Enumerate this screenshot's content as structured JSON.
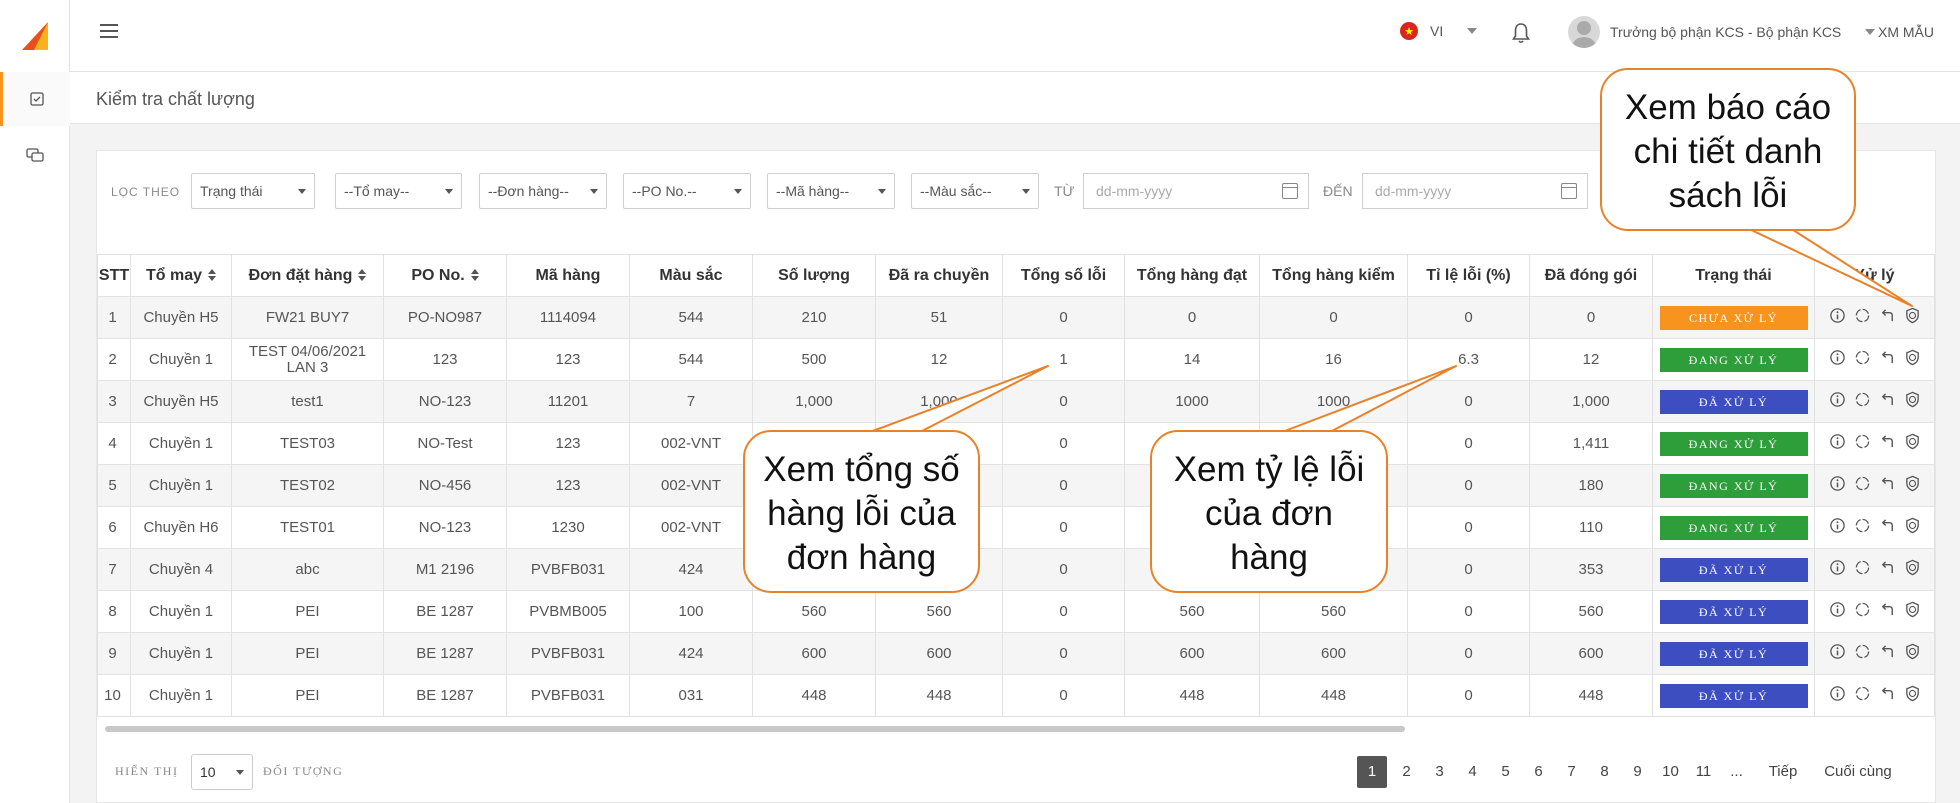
{
  "header": {
    "language": "VI",
    "user": "Trưởng bộ phận KCS - Bộ phận KCS",
    "mode": "XM MẪU"
  },
  "page": {
    "title": "Kiểm tra chất lượng"
  },
  "filters": {
    "label": "LỌC THEO",
    "status": "Trạng thái",
    "team": "--Tổ may--",
    "order": "--Đơn hàng--",
    "po": "--PO No.--",
    "code": "--Mã hàng--",
    "color": "--Màu sắc--",
    "from_label": "TỪ",
    "from_placeholder": "dd-mm-yyyy",
    "to_label": "ĐẾN",
    "to_placeholder": "dd-mm-yyyy"
  },
  "table": {
    "columns": [
      "STT",
      "Tổ may",
      "Đơn đặt hàng",
      "PO No.",
      "Mã hàng",
      "Màu sắc",
      "Số lượng",
      "Đã ra chuyền",
      "Tổng số lỗi",
      "Tổng hàng đạt",
      "Tổng hàng kiểm",
      "Tỉ lệ lỗi (%)",
      "Đã đóng gói",
      "Trạng thái",
      "Xử lý"
    ],
    "rows": [
      {
        "stt": "1",
        "team": "Chuyền H5",
        "order": "FW21 BUY7",
        "po": "PO-NO987",
        "code": "1114094",
        "color": "544",
        "qty": "210",
        "out": "51",
        "defects": "0",
        "passed": "0",
        "checked": "0",
        "rate": "0",
        "packed": "0",
        "status": "CHƯA XỬ LÝ",
        "status_color": "#f7941d"
      },
      {
        "stt": "2",
        "team": "Chuyền 1",
        "order": "TEST 04/06/2021 LAN 3",
        "po": "123",
        "code": "123",
        "color": "544",
        "qty": "500",
        "out": "12",
        "defects": "1",
        "passed": "14",
        "checked": "16",
        "rate": "6.3",
        "packed": "12",
        "status": "ĐANG XỬ LÝ",
        "status_color": "#2e9e3a"
      },
      {
        "stt": "3",
        "team": "Chuyền H5",
        "order": "test1",
        "po": "NO-123",
        "code": "11201",
        "color": "7",
        "qty": "1,000",
        "out": "1,000",
        "defects": "0",
        "passed": "1000",
        "checked": "1000",
        "rate": "0",
        "packed": "1,000",
        "status": "ĐÃ XỬ LÝ",
        "status_color": "#3d4fc0"
      },
      {
        "stt": "4",
        "team": "Chuyền 1",
        "order": "TEST03",
        "po": "NO-Test",
        "code": "123",
        "color": "002-VNT",
        "qty": "",
        "out": "",
        "defects": "0",
        "passed": "",
        "checked": "",
        "rate": "0",
        "packed": "1,411",
        "status": "ĐANG XỬ LÝ",
        "status_color": "#2e9e3a"
      },
      {
        "stt": "5",
        "team": "Chuyền 1",
        "order": "TEST02",
        "po": "NO-456",
        "code": "123",
        "color": "002-VNT",
        "qty": "",
        "out": "",
        "defects": "0",
        "passed": "",
        "checked": "",
        "rate": "0",
        "packed": "180",
        "status": "ĐANG XỬ LÝ",
        "status_color": "#2e9e3a"
      },
      {
        "stt": "6",
        "team": "Chuyền H6",
        "order": "TEST01",
        "po": "NO-123",
        "code": "1230",
        "color": "002-VNT",
        "qty": "",
        "out": "",
        "defects": "0",
        "passed": "",
        "checked": "",
        "rate": "0",
        "packed": "110",
        "status": "ĐANG XỬ LÝ",
        "status_color": "#2e9e3a"
      },
      {
        "stt": "7",
        "team": "Chuyền 4",
        "order": "abc",
        "po": "M1 2196",
        "code": "PVBFB031",
        "color": "424",
        "qty": "",
        "out": "",
        "defects": "0",
        "passed": "",
        "checked": "",
        "rate": "0",
        "packed": "353",
        "status": "ĐÃ XỬ LÝ",
        "status_color": "#3d4fc0"
      },
      {
        "stt": "8",
        "team": "Chuyền 1",
        "order": "PEI",
        "po": "BE 1287",
        "code": "PVBMB005",
        "color": "100",
        "qty": "560",
        "out": "560",
        "defects": "0",
        "passed": "560",
        "checked": "560",
        "rate": "0",
        "packed": "560",
        "status": "ĐÃ XỬ LÝ",
        "status_color": "#3d4fc0"
      },
      {
        "stt": "9",
        "team": "Chuyền 1",
        "order": "PEI",
        "po": "BE 1287",
        "code": "PVBFB031",
        "color": "424",
        "qty": "600",
        "out": "600",
        "defects": "0",
        "passed": "600",
        "checked": "600",
        "rate": "0",
        "packed": "600",
        "status": "ĐÃ XỬ LÝ",
        "status_color": "#3d4fc0"
      },
      {
        "stt": "10",
        "team": "Chuyền 1",
        "order": "PEI",
        "po": "BE 1287",
        "code": "PVBFB031",
        "color": "031",
        "qty": "448",
        "out": "448",
        "defects": "0",
        "passed": "448",
        "checked": "448",
        "rate": "0",
        "packed": "448",
        "status": "ĐÃ XỬ LÝ",
        "status_color": "#3d4fc0"
      }
    ]
  },
  "footer": {
    "show_label": "HIỂN THỊ",
    "page_size": "10",
    "items_label": "ĐỐI TƯỢNG",
    "pages": [
      "1",
      "2",
      "3",
      "4",
      "5",
      "6",
      "7",
      "8",
      "9",
      "10",
      "11",
      "..."
    ],
    "next": "Tiếp",
    "last": "Cuối cùng"
  },
  "callouts": {
    "report": "Xem báo cáo chi tiết danh sách lỗi",
    "defects": "Xem tổng số hàng lỗi của đơn hàng",
    "rate": "Xem tỷ lệ lỗi của đơn hàng"
  },
  "colors": {
    "accent": "#f7941d",
    "callout_border": "#e8822a"
  }
}
